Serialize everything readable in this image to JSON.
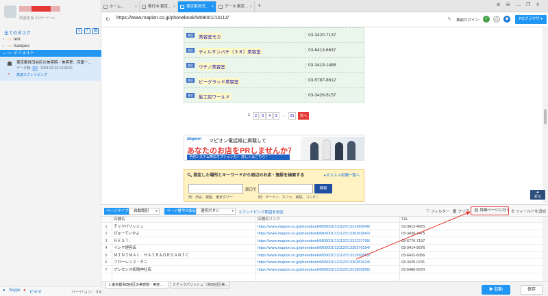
{
  "sidebar": {
    "username": "████████",
    "user_hint": "到金を払う口ード >>",
    "tasks_header": "全てのタスク",
    "tree": [
      {
        "arrow": "›",
        "label": "test"
      },
      {
        "arrow": "›",
        "label": "Samples"
      },
      {
        "arrow": "⌄",
        "label": "デフォルト"
      }
    ],
    "task": {
      "title": "東京都世田谷区の美容院・美容室：床屋一...",
      "meta_prefix": "データ数:",
      "meta_count": "152",
      "meta_date": "2024-02-23 13:43:22",
      "link": "高速スクレイピング"
    },
    "bottom": {
      "skype": "Skype",
      "video": "ビデオ",
      "version": "バージョン：3.6.4"
    }
  },
  "tabs": [
    {
      "label": "ホーム..."
    },
    {
      "label": "実行中:東京..."
    },
    {
      "label": "東京都世田..."
    },
    {
      "label": "データ:東京..."
    }
  ],
  "address": {
    "url": "https://www.mapion.co.jp/phonebook/M09001/13112/",
    "login": "事前ログイン",
    "pc_browser": "PCブラウザ"
  },
  "shops": [
    {
      "icon": "美容",
      "name": "美容室モカ",
      "tel": "03-3420-7137"
    },
    {
      "icon": "美容",
      "name": "ティルサンバチ（３８）美容室",
      "tel": "03-6413-6637"
    },
    {
      "icon": "美容",
      "name": "ウチノ美容室",
      "tel": "03-3419-1488"
    },
    {
      "icon": "美容",
      "name": "ビーグラッド美容室",
      "tel": "03-5787-8612"
    },
    {
      "icon": "美容",
      "name": "髪工房ワールド",
      "tel": "03-3426-5157"
    }
  ],
  "pager": [
    "1",
    "2",
    "3",
    "4",
    "5",
    "...",
    "21",
    "次へ"
  ],
  "ad": {
    "logo": "Mapion",
    "line1": "マピオン電話帳に掲載して",
    "line2": "あなたのお店をPRしませんか？",
    "line3": "予約システム等のオプションも！ 詳しくはこちら！"
  },
  "search": {
    "title": "指定した場所とキーワードから周辺のお店・施設を検索する",
    "link": "オススメ店舗一覧へ",
    "near_label": "周辺で",
    "button": "検索",
    "hint1": "例：渋谷、銀座、東京タワー",
    "hint2": "例：ラーメン、カフェ、病院、コンビニ"
  },
  "collapse_label": "折る",
  "toolbar": {
    "page_type_tag": "ページタイプ",
    "page_type_value": "自動識別",
    "page_num_tag": "ページ番号の設定",
    "page_num_value": "選択ボタン",
    "scrape_link": "スクレイピング範囲を設定",
    "filter": "フィルター",
    "clear": "クリア",
    "detail": "詳細ページに行く",
    "add_field": "フィールドを追加"
  },
  "grid": {
    "headers": [
      "店舗名",
      "店舗名リンク",
      "TEL"
    ],
    "rows": [
      {
        "n": "1",
        "name": "チャクパリッシュ",
        "link": "https://www.mapion.co.jp/phonebook/M09001/13112/21331495649/",
        "tel": "03-3412-4975"
      },
      {
        "n": "2",
        "name": "ぴゅーていかよ",
        "link": "https://www.mapion.co.jp/phonebook/M09001/13112/21330363841/",
        "tel": "03-3426-7475"
      },
      {
        "n": "3",
        "name": "ＲＥＳＴ．",
        "link": "https://www.mapion.co.jp/phonebook/M09001/13112/21331221799/",
        "tel": "03-6776-7197"
      },
      {
        "n": "4",
        "name": "イシヤ理容店",
        "link": "https://www.mapion.co.jp/phonebook/M09001/13112/21330376154/",
        "tel": "03-3414-9576"
      },
      {
        "n": "5",
        "name": "ＭＩＮＩＭＡＬ　ＨＡＩＲ＆ＯＲＧＡＮＩＣ",
        "link": "https://www.mapion.co.jp/phonebook/M09001/13112/21331990853/",
        "tel": "03-6432-6056"
      },
      {
        "n": "6",
        "name": "フローレンス・タニ",
        "link": "https://www.mapion.co.jp/phonebook/M09001/13112/21330352624/",
        "tel": "03-3425-0731"
      },
      {
        "n": "7",
        "name": "プレセンス松陰神社店",
        "link": "https://www.mapion.co.jp/phonebook/M09001/13112/21331605865/",
        "tel": "03-5486-6070"
      }
    ]
  },
  "bottom_tabs": [
    {
      "label": "1  東京都世田谷区の美容院・美容..."
    },
    {
      "label": "2  チャクパリッシュ（世田谷区/美..."
    }
  ],
  "actions": {
    "start": "▶ 起動",
    "save": "保存"
  },
  "colors": {
    "accent": "#2196f3",
    "highlight": "#e53935"
  }
}
